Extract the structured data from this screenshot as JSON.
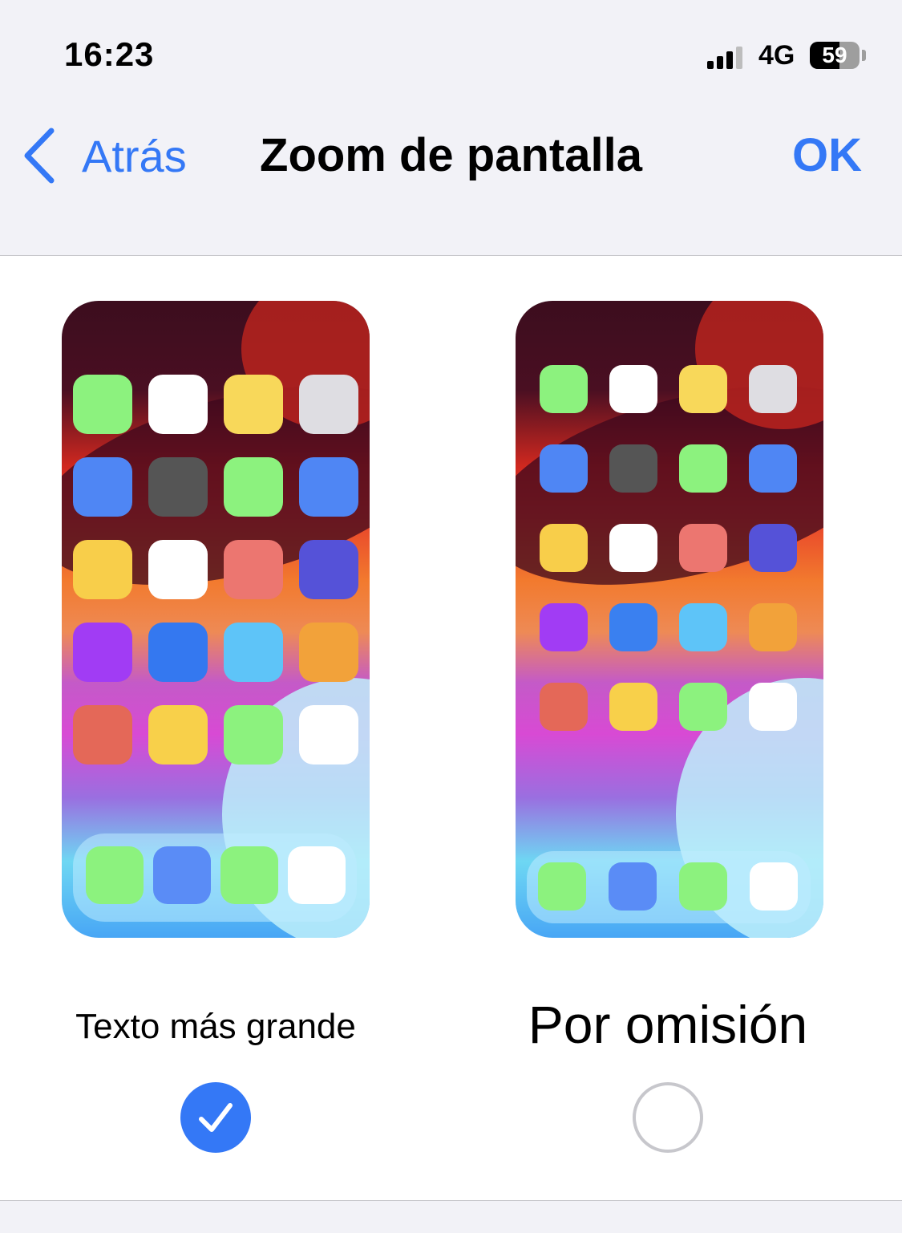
{
  "status": {
    "time": "16:23",
    "network": "4G",
    "battery": "59",
    "battery_level": 0.59
  },
  "nav": {
    "back_label": "Atrás",
    "title": "Zoom de pantalla",
    "ok_label": "OK"
  },
  "options": [
    {
      "label": "Texto más grande",
      "selected": true
    },
    {
      "label": "Por omisión",
      "selected": false
    }
  ],
  "colors": {
    "accent": "#3478f6"
  },
  "app_icon_colors": {
    "larger": [
      [
        "#8cf27e",
        "#ffffff",
        "#f8d85a",
        "#dedde2"
      ],
      [
        "#4f86f4",
        "#555555",
        "#8cf27e",
        "#4f86f4"
      ],
      [
        "#f8ce4a",
        "#ffffff",
        "#ec7670",
        "#5552d8"
      ],
      [
        "#a13cf4",
        "#3478f0",
        "#5ec4f8",
        "#f2a23a"
      ],
      [
        "#e46858",
        "#f8d04a",
        "#8cf27e",
        "#ffffff"
      ]
    ],
    "larger_dock": [
      "#8cf27e",
      "#5a8cf6",
      "#8cf27e",
      "#ffffff"
    ],
    "default": [
      [
        "#8cf27e",
        "#ffffff",
        "#f8d85a",
        "#dedde2"
      ],
      [
        "#4f86f4",
        "#555555",
        "#8cf27e",
        "#4f86f4"
      ],
      [
        "#f8ce4a",
        "#ffffff",
        "#ec7670",
        "#5552d8"
      ],
      [
        "#a13cf4",
        "#3a80f0",
        "#5ec4f8",
        "#f2a23a"
      ],
      [
        "#e46858",
        "#f8d04a",
        "#8cf27e",
        "#ffffff"
      ]
    ],
    "default_dock": [
      "#8cf27e",
      "#5a8cf6",
      "#8cf27e",
      "#ffffff"
    ]
  }
}
